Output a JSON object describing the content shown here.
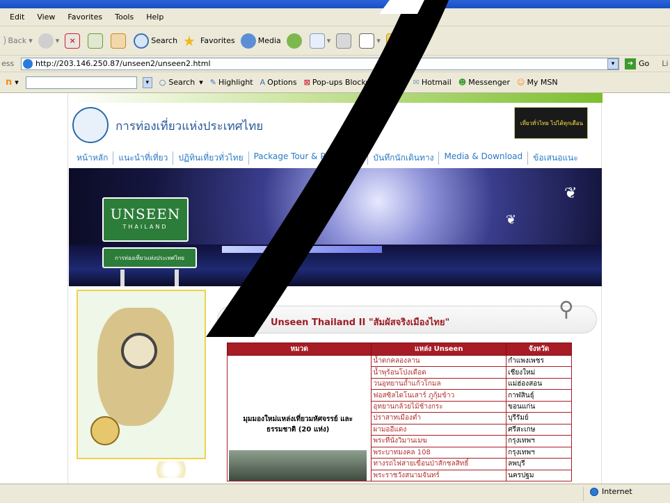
{
  "menubar": {
    "items": [
      "Edit",
      "View",
      "Favorites",
      "Tools",
      "Help"
    ]
  },
  "toolbar": {
    "back": "Back",
    "search": "Search",
    "favorites": "Favorites",
    "media": "Media"
  },
  "address": {
    "label": "ess",
    "url": "http://203.146.250.87/unseen2/unseen2.html",
    "go": "Go",
    "links": "Li"
  },
  "msnbar": {
    "search": "Search",
    "highlight": "Highlight",
    "options": "Options",
    "popups": "Pop-ups Blocked (292)",
    "hotmail": "Hotmail",
    "messenger": "Messenger",
    "mymsn": "My MSN"
  },
  "site": {
    "org_name": "การท่องเที่ยวแห่งประเทศไทย",
    "promo_text": "เที่ยวทั่วไทย ไปได้ทุกเดือน",
    "nav": [
      "หน้าหลัก",
      "แนะนำที่เที่ยว",
      "ปฏิทินเที่ยวทั่วไทย",
      "Package Tour & Promotion",
      "บันทึกนักเดินทาง",
      "Media & Download",
      "ข้อเสนอแนะ"
    ],
    "sign_big": "UNSEEN",
    "sign_small": "THAILAND",
    "sign_org": "การท่องเที่ยวแห่งประเทศไทย",
    "banner_title": "Unseen Thailand II \"สัมผัสจริงเมืองไทย\""
  },
  "table": {
    "headers": [
      "หมวด",
      "แหล่ง Unseen",
      "จังหวัด"
    ],
    "category": "มุมมองใหม่แหล่งเที่ยวมหัศจรรย์ และธรรมชาติ (20 แห่ง)",
    "rows": [
      {
        "place": "น้ำตกคลองลาน",
        "province": "กำแพงเพชร"
      },
      {
        "place": "น้ำพุร้อนโป่งเดือด",
        "province": "เชียงใหม่"
      },
      {
        "place": "วนอุทยานถ้ำแก้วโกมล",
        "province": "แม่ฮ่องสอน"
      },
      {
        "place": "ฟอสซิลไดโนเสาร์ ภูกุ้มข้าว",
        "province": "กาฬสินธุ์"
      },
      {
        "place": "อุทยานกล้วยไม้ช้างกระ",
        "province": "ขอนแก่น"
      },
      {
        "place": "ปราสาทเมืองต่ำ",
        "province": "บุรีรัมย์"
      },
      {
        "place": "ผามออีแดง",
        "province": "ศรีสะเกษ"
      },
      {
        "place": "พระที่นั่งวิมานเมฆ",
        "province": "กรุงเทพฯ"
      },
      {
        "place": "พระบาทมงคล 108",
        "province": "กรุงเทพฯ"
      },
      {
        "place": "ทางรถไฟสายเขื่อนป่าสักชลสิทธิ์",
        "province": "ลพบุรี"
      },
      {
        "place": "พระราชวังสนามจันทร์",
        "province": "นครปฐม"
      }
    ]
  },
  "status": {
    "zone": "Internet"
  }
}
